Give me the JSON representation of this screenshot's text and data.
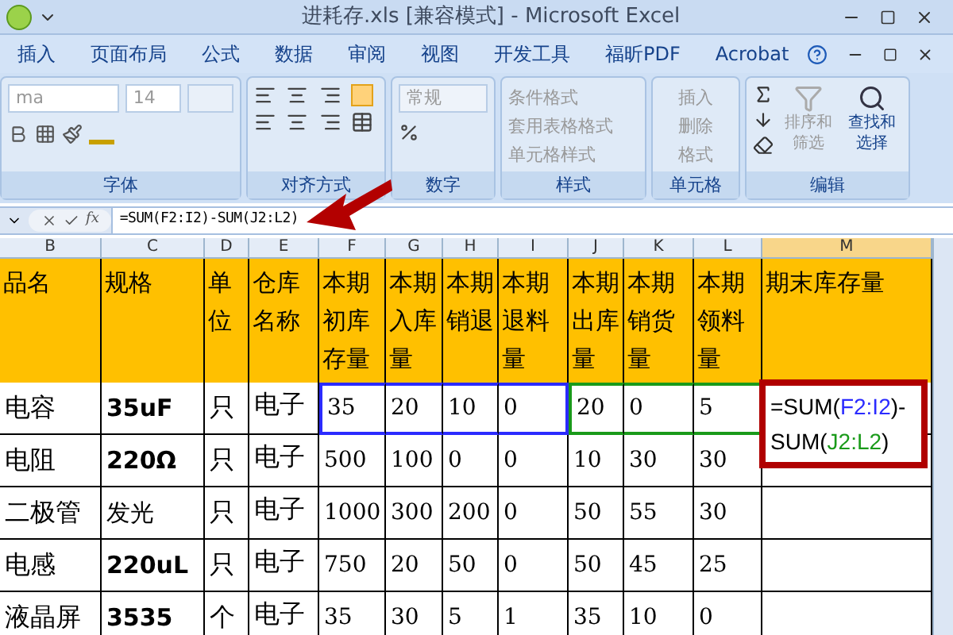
{
  "window": {
    "title": "进耗存.xls  [兼容模式]  -  Microsoft Excel"
  },
  "tabs": [
    {
      "label": "插入",
      "selected": false
    },
    {
      "label": "页面布局",
      "selected": false
    },
    {
      "label": "公式",
      "selected": false
    },
    {
      "label": "数据",
      "selected": false
    },
    {
      "label": "审阅",
      "selected": false
    },
    {
      "label": "视图",
      "selected": false
    },
    {
      "label": "开发工具",
      "selected": false
    },
    {
      "label": "福昕PDF",
      "selected": false
    },
    {
      "label": "Acrobat",
      "selected": false
    }
  ],
  "ribbon": {
    "font_name": "ma",
    "font_size": "14",
    "number_format": "常规",
    "styles_items": [
      "条件格式",
      "套用表格格式",
      "单元格样式"
    ],
    "cells_items": [
      "插入",
      "删除",
      "格式"
    ],
    "sort_label": "排序和筛选",
    "find_label": "查找和选择",
    "groups": [
      "字体",
      "对齐方式",
      "数字",
      "样式",
      "单元格",
      "编辑"
    ]
  },
  "formula_bar": {
    "fx_symbol": "fx",
    "formula": "=SUM(F2:I2)-SUM(J2:L2)"
  },
  "table": {
    "columns": [
      "B",
      "C",
      "D",
      "E",
      "F",
      "G",
      "H",
      "I",
      "J",
      "K",
      "L",
      "M"
    ],
    "headers": [
      "品名",
      "规格",
      "单位",
      "仓库名称",
      "本期初库存量",
      "本期入库量",
      "本期销退",
      "本期退料量",
      "本期出库量",
      "本期销货量",
      "本期领料量",
      "期末库存量"
    ],
    "rows": [
      {
        "name": "电容",
        "spec": "35uF",
        "spec_bold": true,
        "unit": "只",
        "warehouse": "电子",
        "values": [
          "35",
          "20",
          "10",
          "0",
          "20",
          "0",
          "5"
        ],
        "outlines": [
          {
            "color": "#2b2bff"
          },
          {
            "color": "#2b2bff"
          },
          {
            "color": "#2b2bff"
          },
          {
            "color": "#2b2bff"
          },
          {
            "color": "#1a9a1a"
          },
          {
            "color": "#1a9a1a"
          },
          {
            "color": "#1a9a1a"
          }
        ],
        "formula_parts": [
          {
            "text": "=SUM(",
            "color": "#000000"
          },
          {
            "text": "F2:I2",
            "color": "#2b2bff"
          },
          {
            "text": ")-SUM(",
            "color": "#000000"
          },
          {
            "text": "J2:L2",
            "color": "#1a9a1a"
          },
          {
            "text": ")",
            "color": "#000000"
          }
        ]
      },
      {
        "name": "电阻",
        "spec": "220Ω",
        "spec_bold": true,
        "unit": "只",
        "warehouse": "电子",
        "values": [
          "500",
          "100",
          "0",
          "0",
          "10",
          "30",
          "30"
        ]
      },
      {
        "name": "二极管",
        "spec": "发光",
        "spec_bold": false,
        "unit": "只",
        "warehouse": "电子",
        "values": [
          "1000",
          "300",
          "200",
          "0",
          "50",
          "55",
          "30"
        ]
      },
      {
        "name": "电感",
        "spec": "220uL",
        "spec_bold": true,
        "unit": "只",
        "warehouse": "电子",
        "values": [
          "750",
          "20",
          "50",
          "0",
          "50",
          "45",
          "25"
        ]
      },
      {
        "name": "液晶屏",
        "spec": "3535",
        "spec_bold": true,
        "unit": "个",
        "warehouse": "电子",
        "values": [
          "35",
          "30",
          "5",
          "1",
          "35",
          "10",
          "0"
        ]
      }
    ]
  }
}
